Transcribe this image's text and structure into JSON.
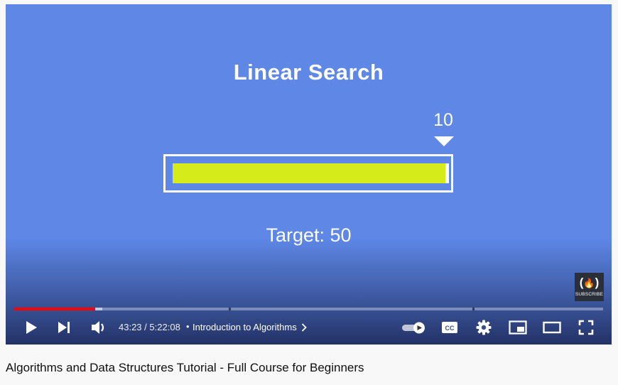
{
  "slide": {
    "title": "Linear Search",
    "index_label": "10",
    "target_text": "Target: 50"
  },
  "logo": {
    "glyph": "(🔥)",
    "caption": "SUBSCRIBE"
  },
  "player": {
    "played_fraction": 0.138,
    "buffered_fraction": 0.15,
    "time_current": "43:23",
    "time_separator": "/",
    "time_total": "5:22:08",
    "bullet": "•",
    "chapter_title": "Introduction to Algorithms",
    "icons": [
      "play-icon",
      "next-icon",
      "volume-icon",
      "autoplay-toggle-icon",
      "cc-icon",
      "settings-icon",
      "miniplayer-icon",
      "theater-icon",
      "fullscreen-icon"
    ],
    "accent_color": "#ff0000"
  },
  "video": {
    "title": "Algorithms and Data Structures Tutorial - Full Course for Beginners"
  }
}
